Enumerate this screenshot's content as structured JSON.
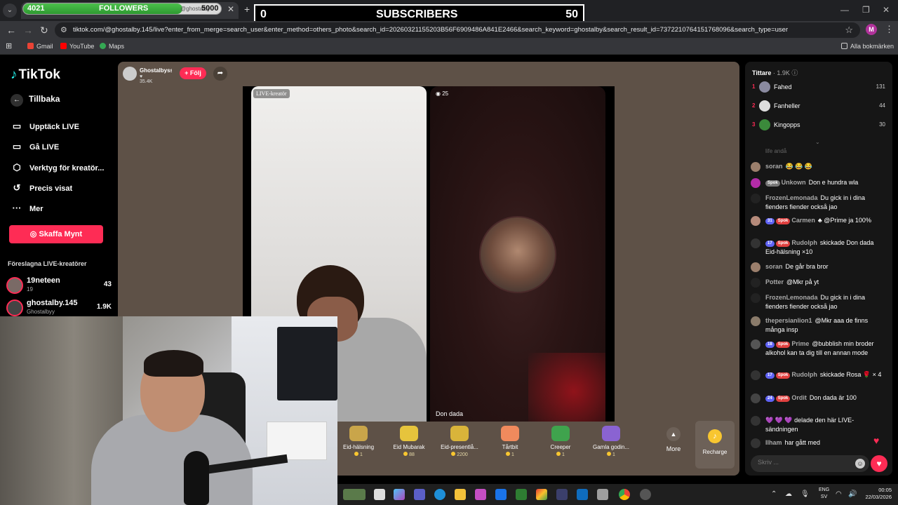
{
  "overlay": {
    "followers": {
      "current": "4021",
      "label": "FOLLOWERS",
      "goal": "5000",
      "progress": 0.8042
    },
    "subscribers": {
      "current": "0",
      "label": "SUBSCRIBERS",
      "goal": "50"
    }
  },
  "browser": {
    "tab_title": "@ghostalby",
    "url": "tiktok.com/@ghostalby.145/live?enter_from_merge=search_user&enter_method=others_photo&search_id=20260321155203B56F6909486A841E2466&search_keyword=ghostalby&search_result_id=7372210764151768096&search_type=user",
    "profile_initial": "M",
    "bookmarks": [
      "Gmail",
      "YouTube",
      "Maps"
    ],
    "all_bookmarks": "Alla bokmärken"
  },
  "sidebar": {
    "logo": "TikTok",
    "back": "Tillbaka",
    "items": [
      {
        "label": "Upptäck LIVE",
        "icon": "live-tv-icon"
      },
      {
        "label": "Gå LIVE",
        "icon": "video-camera-icon"
      },
      {
        "label": "Verktyg för kreatör...",
        "icon": "creator-tools-icon"
      },
      {
        "label": "Precis visat",
        "icon": "history-icon"
      },
      {
        "label": "Mer",
        "icon": "more-dots-icon"
      }
    ],
    "coins_button": "Skaffa Mynt",
    "suggested_title": "Föreslagna LIVE-kreatörer",
    "suggested": [
      {
        "name": "19neteen",
        "sub": "19",
        "count": "43"
      },
      {
        "name": "ghostalby.145",
        "sub": "Ghostalbyy",
        "count": "1.9K"
      }
    ]
  },
  "stream": {
    "host_name": "Ghostalbyss",
    "host_likes": "35.4K",
    "follow": "+ Följ",
    "live_badge": "LIVE-kreatör",
    "guest_viewers": "25",
    "guest_name": "Don dada"
  },
  "gifts": [
    {
      "name": "Eid-hälsning",
      "price": "1",
      "color": "#c9a54a",
      "icon": "eid-greeting-icon"
    },
    {
      "name": "Eid Mubarak",
      "price": "88",
      "color": "#e6c43c",
      "icon": "eid-mubarak-icon"
    },
    {
      "name": "Eid-presentlå...",
      "price": "2200",
      "color": "#d9b43a",
      "icon": "gift-box-icon"
    },
    {
      "name": "Tårtbit",
      "price": "1",
      "color": "#f08a5d",
      "icon": "cake-icon"
    },
    {
      "name": "Creeper",
      "price": "1",
      "color": "#3fa34d",
      "icon": "creeper-icon"
    },
    {
      "name": "Gamla godin...",
      "price": "1",
      "color": "#8a63d2",
      "icon": "candy-icon"
    }
  ],
  "gift_more": "More",
  "recharge": "Recharge",
  "chat": {
    "viewers_label": "Tittare",
    "viewers_count": "1.9K",
    "top_viewers": [
      {
        "rank": "1",
        "name": "Fahed",
        "score": "131",
        "color": "#8a8aa0"
      },
      {
        "rank": "2",
        "name": "Fanheller",
        "score": "44",
        "color": "#ddd"
      },
      {
        "rank": "3",
        "name": "Kingopps",
        "score": "30",
        "color": "#3b8a3b"
      }
    ],
    "faded": "life andå",
    "messages": [
      {
        "user": "soran",
        "badges": [],
        "text": "😂 😂 😂",
        "color": "#9b7f6c"
      },
      {
        "user": "Unkown",
        "badges": [
          {
            "t": "Spok",
            "c": "grey"
          }
        ],
        "text": "Don e hundra wla",
        "color": "#b32ca8"
      },
      {
        "user": "FrozenLemonada",
        "badges": [],
        "text": "Du gick in i dina fienders fiender också jao",
        "color": "#222"
      },
      {
        "user": "Carmen",
        "badges": [
          {
            "t": "31",
            "c": "level"
          },
          {
            "t": "Spok",
            "c": "spok"
          }
        ],
        "text": "♣ @Prime ja 100%",
        "color": "#b58a7a"
      },
      {
        "user": "Rudolph",
        "badges": [
          {
            "t": "17",
            "c": "level"
          },
          {
            "t": "Spok",
            "c": "spok"
          }
        ],
        "text": "skickade Don dada Eid-hälsning ×10",
        "color": "#333"
      },
      {
        "user": "soran",
        "badges": [],
        "text": "De går bra bror",
        "color": "#9b7f6c"
      },
      {
        "user": "Potter",
        "badges": [],
        "text": "@Mkr på yt",
        "color": "#222"
      },
      {
        "user": "FrozenLemonada",
        "badges": [],
        "text": "Du gick in i dina fienders fiender också jao",
        "color": "#222"
      },
      {
        "user": "thepersianlion1",
        "badges": [],
        "text": "@Mkr aaa de finns många insp",
        "color": "#8a7b6a"
      },
      {
        "user": "Prime",
        "badges": [
          {
            "t": "18",
            "c": "level"
          },
          {
            "t": "Spok",
            "c": "spok"
          }
        ],
        "text": "@bubblish min broder alkohol kan ta dig till en annan mode",
        "color": "#555"
      },
      {
        "user": "Rudolph",
        "badges": [
          {
            "t": "17",
            "c": "level"
          },
          {
            "t": "Spok",
            "c": "spok"
          }
        ],
        "text": "skickade Rosa 🌹 × 4",
        "color": "#333"
      },
      {
        "user": "Ordit",
        "badges": [
          {
            "t": "24",
            "c": "level"
          },
          {
            "t": "Spok",
            "c": "spok"
          }
        ],
        "text": "Don dada är 100",
        "color": "#444"
      },
      {
        "user": "",
        "badges": [],
        "text": "💜 💜 💜 delade den här LIVE-sändningen",
        "color": "#333"
      },
      {
        "user": "Ilham",
        "badges": [],
        "text": "har gått med",
        "color": "#333"
      }
    ],
    "input_placeholder": "Skriv ..."
  },
  "taskbar": {
    "lang": "ENG",
    "region": "SV",
    "time": "00:05",
    "date": "22/03/2026"
  }
}
